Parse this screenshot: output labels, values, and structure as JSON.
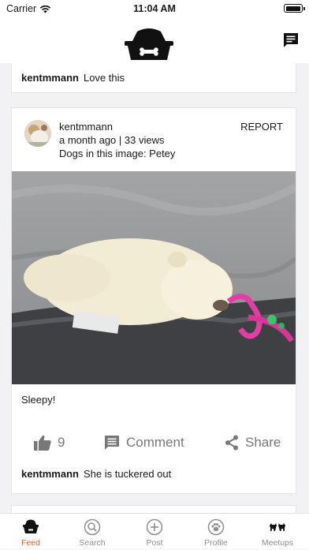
{
  "status_bar": {
    "carrier": "Carrier",
    "time": "11:04 AM",
    "battery_level": 1.0
  },
  "icons": {
    "logo": "dog-bowl-bone-logo",
    "messages": "message-icon",
    "like": "thumbs-up-icon",
    "comment": "comment-icon",
    "share": "share-icon"
  },
  "feed": {
    "previous_comment": {
      "user": "kentmmann",
      "text": "Love this"
    },
    "post": {
      "user": "kentmmann",
      "meta": "a month ago | 33 views",
      "dogs": "Dogs in this image: Petey",
      "report_label": "REPORT",
      "caption": "Sleepy!",
      "likes": "9",
      "comment_label": "Comment",
      "share_label": "Share",
      "comment": {
        "user": "kentmmann",
        "text": "She is tuckered out"
      }
    }
  },
  "tabs": [
    {
      "label": "Feed",
      "icon": "feed-bowl-icon",
      "active": true
    },
    {
      "label": "Search",
      "icon": "search-icon",
      "active": false
    },
    {
      "label": "Post",
      "icon": "add-icon",
      "active": false
    },
    {
      "label": "Profile",
      "icon": "paw-icon",
      "active": false
    },
    {
      "label": "Meetups",
      "icon": "dogs-icon",
      "active": false
    }
  ],
  "colors": {
    "accent": "#e8582a",
    "text": "#1a1a1a",
    "muted": "#777777",
    "background": "#f2f2f4"
  }
}
